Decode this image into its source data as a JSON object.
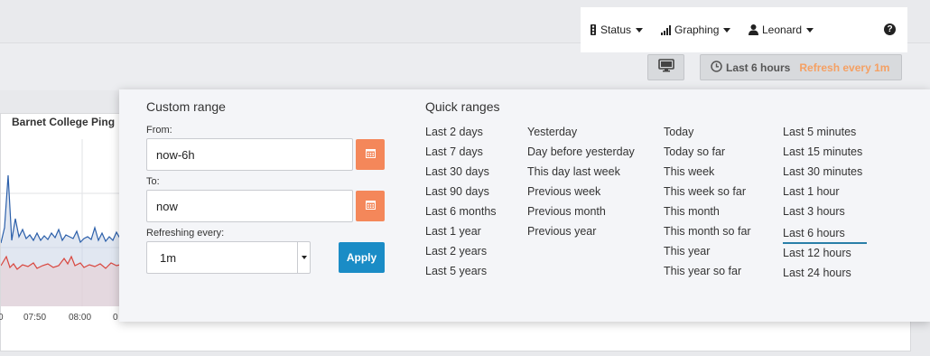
{
  "navbar": {
    "status_label": "Status",
    "graphing_label": "Graphing",
    "user_label": "Leonard",
    "help_glyph": "?"
  },
  "toolbar": {
    "kiosk_icon": "monitor-icon",
    "time_range_label": "Last 6 hours",
    "refresh_label": "Refresh every 1m",
    "refresh_color": "#f5a063"
  },
  "panel": {
    "title": "Barnet College Ping",
    "x_ticks": [
      "0",
      "07:50",
      "08:00",
      "0"
    ],
    "series_colors": {
      "blue": "#2b5faa",
      "red": "#d9463e"
    }
  },
  "time_picker": {
    "custom_range": {
      "title": "Custom range",
      "from_label": "From:",
      "from_value": "now-6h",
      "to_label": "To:",
      "to_value": "now",
      "refresh_label": "Refreshing every:",
      "refresh_value": "1m",
      "apply_label": "Apply",
      "calendar_color": "#f4875a",
      "apply_color": "#1a8cc6"
    },
    "quick_ranges": {
      "title": "Quick ranges",
      "col1": [
        "Last 2 days",
        "Last 7 days",
        "Last 30 days",
        "Last 90 days",
        "Last 6 months",
        "Last 1 year",
        "Last 2 years",
        "Last 5 years"
      ],
      "col2": [
        "Yesterday",
        "Day before yesterday",
        "This day last week",
        "Previous week",
        "Previous month",
        "Previous year"
      ],
      "col3": [
        "Today",
        "Today so far",
        "This week",
        "This week so far",
        "This month",
        "This month so far",
        "This year",
        "This year so far"
      ],
      "col4": [
        "Last 5 minutes",
        "Last 15 minutes",
        "Last 30 minutes",
        "Last 1 hour",
        "Last 3 hours",
        "Last 6 hours",
        "Last 12 hours",
        "Last 24 hours"
      ],
      "active": "Last 6 hours"
    }
  }
}
